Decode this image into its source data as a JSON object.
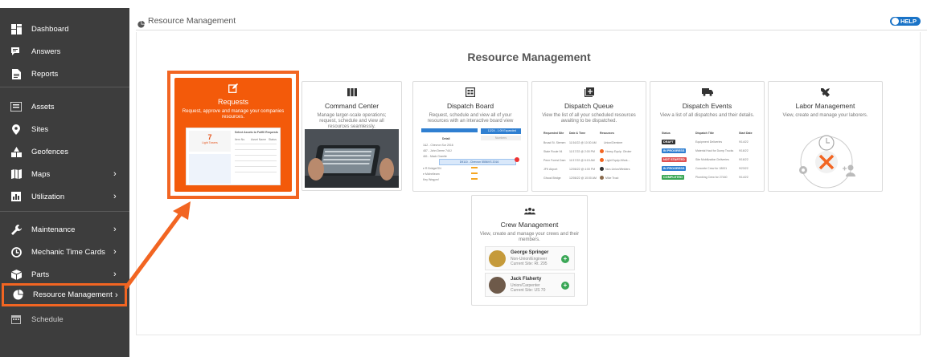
{
  "sidebar": {
    "items": [
      {
        "label": "Dashboard",
        "icon": "dashboard-icon",
        "chevron": false
      },
      {
        "label": "Answers",
        "icon": "chat-icon",
        "chevron": false
      },
      {
        "label": "Reports",
        "icon": "document-icon",
        "chevron": false
      },
      {
        "label": "Assets",
        "icon": "list-icon",
        "chevron": false
      },
      {
        "label": "Sites",
        "icon": "map-pin-icon",
        "chevron": false
      },
      {
        "label": "Geofences",
        "icon": "geofence-icon",
        "chevron": false
      },
      {
        "label": "Maps",
        "icon": "map-icon",
        "chevron": true
      },
      {
        "label": "Utilization",
        "icon": "bar-chart-icon",
        "chevron": true
      },
      {
        "label": "Maintenance",
        "icon": "wrench-icon",
        "chevron": true
      },
      {
        "label": "Mechanic Time Cards",
        "icon": "clock-icon",
        "chevron": true
      },
      {
        "label": "Parts",
        "icon": "box-icon",
        "chevron": true
      },
      {
        "label": "Resource Management",
        "icon": "pie-icon",
        "chevron": true
      },
      {
        "label": "Schedule",
        "icon": "calendar-icon",
        "chevron": false
      }
    ],
    "chevron_glyph": "›"
  },
  "topbar": {
    "title": "Resource Management",
    "help_label": "HELP"
  },
  "main": {
    "title": "Resource Management",
    "cards": {
      "requests": {
        "title": "Requests",
        "desc": "Request, approve and manage your companies resources.",
        "stat_value": "7",
        "stat_label": "Light Towers",
        "panel_header": "Select Assets to Fulfill Requests",
        "cols": [
          "Item No.",
          "Asset Name",
          "Status"
        ]
      },
      "command_center": {
        "title": "Command Center",
        "desc": "Manage larger-scale operations; request, schedule and view all resources seamlessly."
      },
      "dispatch_board": {
        "title": "Dispatch Board",
        "desc": "Request, schedule and view all of your resources with an interactive board view",
        "detail_header": "Detail",
        "rows": [
          "1&2 - Chevron Sur 2016",
          "487 - John Deere 744J",
          "461 - Mack Granite",
          "e R Bridge/ON",
          "e Michelleam",
          "Key Wegym!"
        ],
        "drag_label": "D9110 - Chevron 5556VS 2016",
        "expanded_label": "12/24 - 1:09 Expanded",
        "numbers_label": "Numbers"
      },
      "dispatch_queue": {
        "title": "Dispatch Queue",
        "desc": "View the list of all your scheduled resources awaiting to be dispatched.",
        "cols": [
          "Requested Site",
          "Date & Time",
          "Resources"
        ],
        "rows": [
          [
            "Broad St. Siemen",
            "11/16/22 @ 10:30 AM",
            "Union/Deminer"
          ],
          [
            "State Route 94",
            "11/17/22 @ 2:00 PM",
            "Heavy Equip. Oiroter"
          ],
          [
            "Penn Forest Dam",
            "11/17/22 @ 6:15 AM",
            "Light Equip./Work..."
          ],
          [
            "JFK Airport",
            "12/06/22 @ 4:00 PM",
            "Non-Union/Welders"
          ],
          [
            "Ghood Bridge",
            "12/06/22 @ 10:00 AM",
            "Mike Trout"
          ]
        ]
      },
      "dispatch_events": {
        "title": "Dispatch Events",
        "desc": "View a list of all dispatches and their details.",
        "cols": [
          "Status",
          "Dispatch Title",
          "Start Date"
        ],
        "rows": [
          {
            "status": "DRAFT",
            "title": "Equipment Deliveries",
            "date": "9/14/22",
            "color": "#333333"
          },
          {
            "status": "IN PROGRESS",
            "title": "Material Haul for Dump Trucks",
            "date": "9/16/22",
            "color": "#2f7fd1"
          },
          {
            "status": "NOT STARTED",
            "title": "Site Mobilization Deliveries",
            "date": "9/16/22",
            "color": "#e05050"
          },
          {
            "status": "IN PROGRESS",
            "title": "Concrete Crew for 18001",
            "date": "9/23/22",
            "color": "#2f7fd1"
          },
          {
            "status": "COMPLETED",
            "title": "Plumbing Crew for 27440",
            "date": "9/14/22",
            "color": "#3aa756"
          }
        ]
      },
      "labor_management": {
        "title": "Labor Management",
        "desc": "View, create and manage your laborers."
      },
      "crew_management": {
        "title": "Crew Management",
        "desc": "View, create and manage your crews and their members.",
        "members": [
          {
            "name": "George Springer",
            "role": "Non-Union/Engineer",
            "site": "Current Site: Rt. 295"
          },
          {
            "name": "Jack Flaherty",
            "role": "Union/Carpenter",
            "site": "Current Site: US 70"
          }
        ]
      }
    }
  },
  "colors": {
    "accent": "#f26522",
    "sidebar_bg": "#3d3d3d",
    "help_blue": "#1a73c7"
  }
}
